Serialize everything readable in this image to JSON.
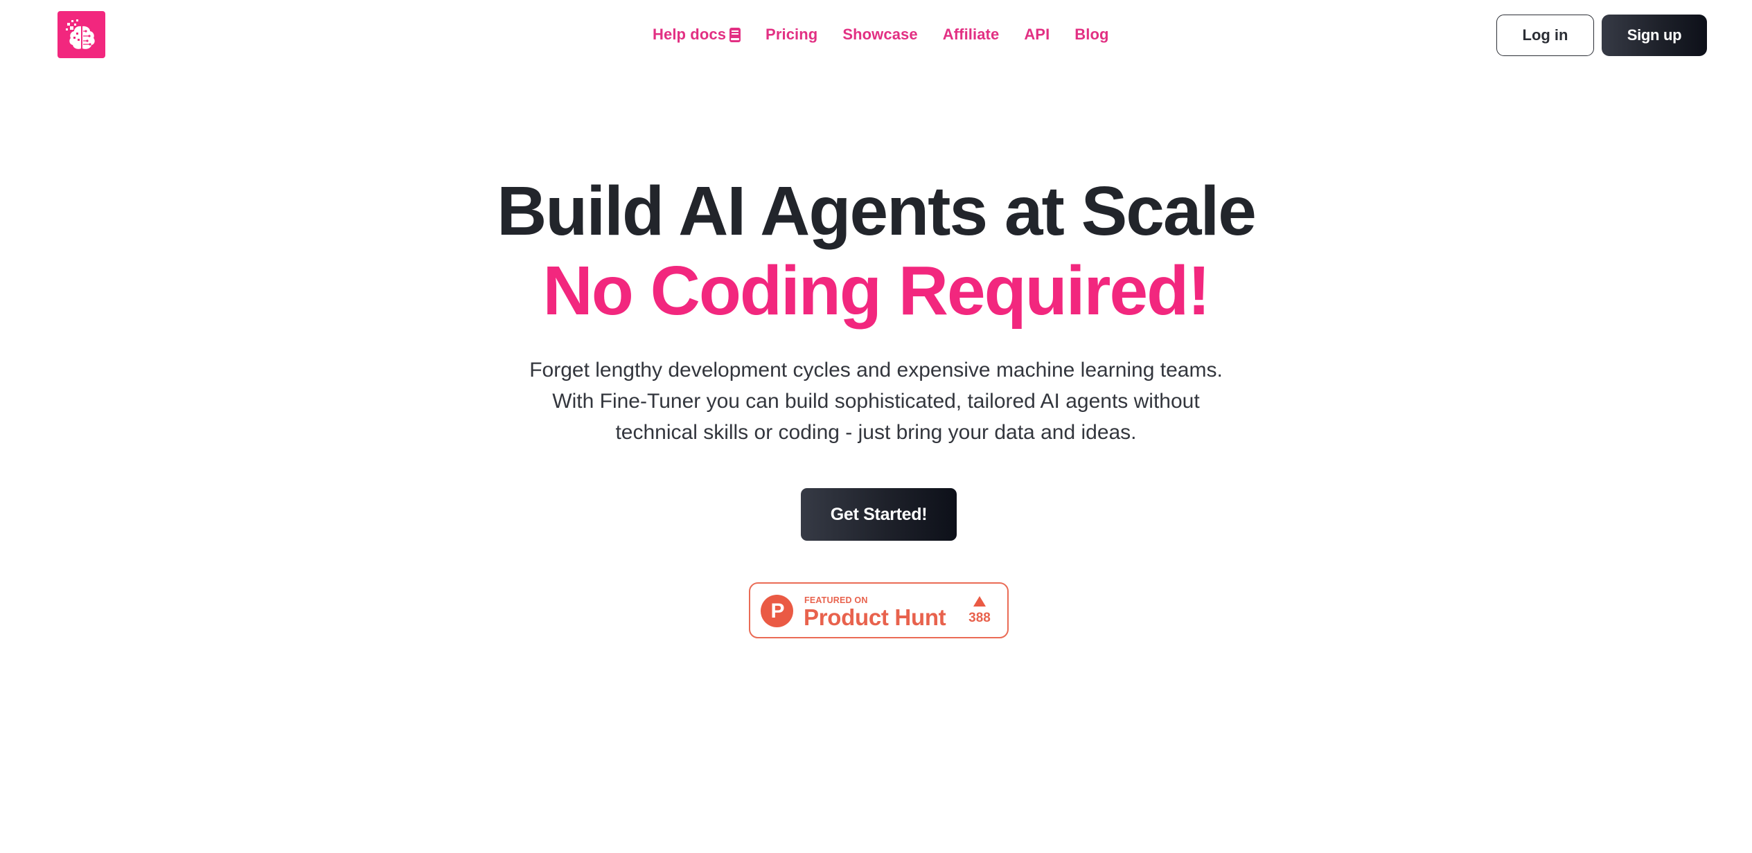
{
  "header": {
    "logo_icon": "brain-circuit-icon",
    "nav": [
      {
        "label": "Help docs",
        "icon": "book-icon"
      },
      {
        "label": "Pricing"
      },
      {
        "label": "Showcase"
      },
      {
        "label": "Affiliate"
      },
      {
        "label": "API"
      },
      {
        "label": "Blog"
      }
    ],
    "login_label": "Log in",
    "signup_label": "Sign up"
  },
  "hero": {
    "title_line1": "Build AI Agents at Scale",
    "title_line2": "No Coding Required!",
    "subtitle_lines": [
      "Forget lengthy development cycles and expensive machine learning teams.",
      "With Fine-Tuner you can build sophisticated, tailored AI agents without",
      "technical skills or coding - just bring your data and ideas."
    ],
    "cta_label": "Get Started!"
  },
  "product_hunt": {
    "logo_letter": "P",
    "featured_label": "FEATURED ON",
    "name": "Product Hunt",
    "upvote_icon": "triangle-up-icon",
    "upvotes": "388"
  },
  "colors": {
    "brand_pink": "#f2277e",
    "nav_pink": "#e23083",
    "dark": "#22252b",
    "product_hunt": "#ea5a44"
  }
}
